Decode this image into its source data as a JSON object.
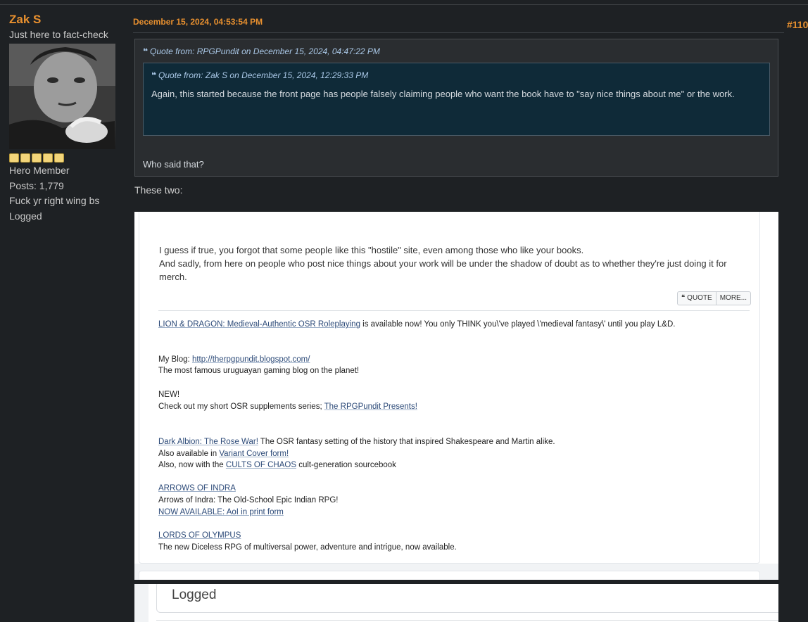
{
  "poster": {
    "name": "Zak S",
    "title": "Just here to fact-check",
    "rank": "Hero Member",
    "posts": "Posts: 1,779",
    "signature": "Fuck yr right wing bs",
    "logged": "Logged",
    "stars": 5
  },
  "post": {
    "date": "December 15, 2024, 04:53:54 PM",
    "number": "#110",
    "outer_quote": {
      "header": "Quote from: RPGPundit on December 15, 2024, 04:47:22 PM",
      "text": "Who said that?"
    },
    "inner_quote": {
      "header": "Quote from: Zak S on December 15, 2024, 12:29:33 PM",
      "text": "Again, this started because the front page has people falsely claiming people who want the book have to \"say nice things about me\" or the work."
    },
    "body": "These two:"
  },
  "screenshot": {
    "para1": "I guess if true, you forgot that some people like this \"hostile\" site, even among those who like your books.",
    "para2": "And sadly, from here on people who post nice things about your work will be under the shadow of doubt as to whether they're just doing it for merch.",
    "quote_btn": "❝ QUOTE",
    "more_btn": "MORE...",
    "sig": {
      "l1_link": "LION & DRAGON: Medieval-Authentic OSR Roleplaying",
      "l1_rest": " is available now! You only THINK you\\'ve played \\'medieval fantasy\\' until you play L&D.",
      "blog_label": "My Blog:  ",
      "blog_link": "http://therpgpundit.blogspot.com/",
      "blog_desc": "The most famous uruguayan gaming blog on the planet!",
      "new": "NEW!",
      "new_desc": "Check out my short OSR supplements series; ",
      "new_link": "The RPGPundit Presents!",
      "da_link": "Dark Albion: The Rose War!",
      "da_rest": " The OSR fantasy setting of the history that inspired Shakespeare and Martin alike.",
      "da2_pre": "Also available in ",
      "da2_link": "Variant Cover form!",
      "da3_pre": "Also, now with the ",
      "da3_link": "CULTS OF CHAOS",
      "da3_rest": " cult-generation sourcebook",
      "aoi_link": "ARROWS OF INDRA",
      "aoi_desc": "Arrows of Indra: The Old-School Epic Indian RPG!",
      "aoi2_link": "NOW AVAILABLE: AoI in print form",
      "loo_link": "LORDS OF OLYMPUS",
      "loo_desc": "The new Diceless RPG of multiversal power, adventure and intrigue, now available."
    },
    "logged": "Logged"
  }
}
